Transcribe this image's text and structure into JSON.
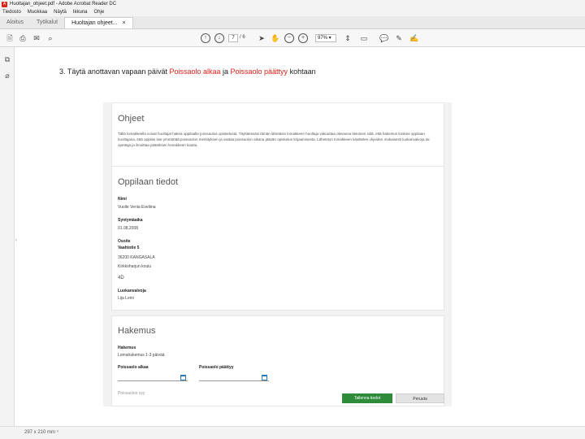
{
  "window": {
    "title": "Huoltajan_ohjeet.pdf - Adobe Acrobat Reader DC"
  },
  "menu": [
    "Tiedosto",
    "Muokkaa",
    "Näytä",
    "Ikkuna",
    "Ohje"
  ],
  "tabs": {
    "home": "Aloitus",
    "tools": "Työkalut",
    "document": "Huoltajan ohjeet...",
    "close": "×"
  },
  "toolbar": {
    "page_current": "7",
    "page_total": "/ 6",
    "zoom": "97%"
  },
  "instruction": {
    "number": "3.",
    "before": "Täytä anottavan vapaan päivät ",
    "field1": "Poissaolo alkaa",
    "middle": " ja ",
    "field2": "Poissaolo päättyy",
    "after": " kohtaan"
  },
  "form": {
    "instructions_title": "Ohjeet",
    "instructions_text": "Tällä lomakkeella voivat huoltajat hakea oppilaalle poissaoloa opiskelusta. Täyttäessäsi tämän lähetäsin lomakkeen huoltaja vakuuttaa olevansa tietoinen siitä, että hakemus koskee oppilaan huoltajana, että oppilas itse ymmärtää poissaolon merkityksen ja vastaa poissaolon aikana jäävän opiskelun kirjaamisesta. Lähetetyn lomakkeen käsittelee ohjeiden mukaisesti luokanvalvoja tai opettaja ja ilmoittaa päätöksen lomakkeen kautta.",
    "student_title": "Oppilaan tiedot",
    "name_label": "Nimi",
    "name_value": "Vuolle Venla Eveliina",
    "birth_label": "Syntymäaika",
    "birth_value": "01.08.2008",
    "address_label": "Osoite",
    "address_line1": "Vaahtotie 5",
    "address_line2": "36200 KANGASALA",
    "school": "Kirkkoharjun koulu",
    "grade": "4D",
    "teacher_label": "Luokanvalvoja",
    "teacher_value": "Lija Leini",
    "application_title": "Hakemus",
    "type_label": "Hakemus",
    "type_value": "Lomahakemus 1-3 päivää",
    "start_label": "Poissaolo alkaa",
    "end_label": "Poissaolo päättyy",
    "reason_label": "Poissaolon syy",
    "save_button": "Tallenna tiedot",
    "cancel_button": "Peruuta"
  },
  "statusbar": {
    "page_size": "297 x 210 mm"
  }
}
